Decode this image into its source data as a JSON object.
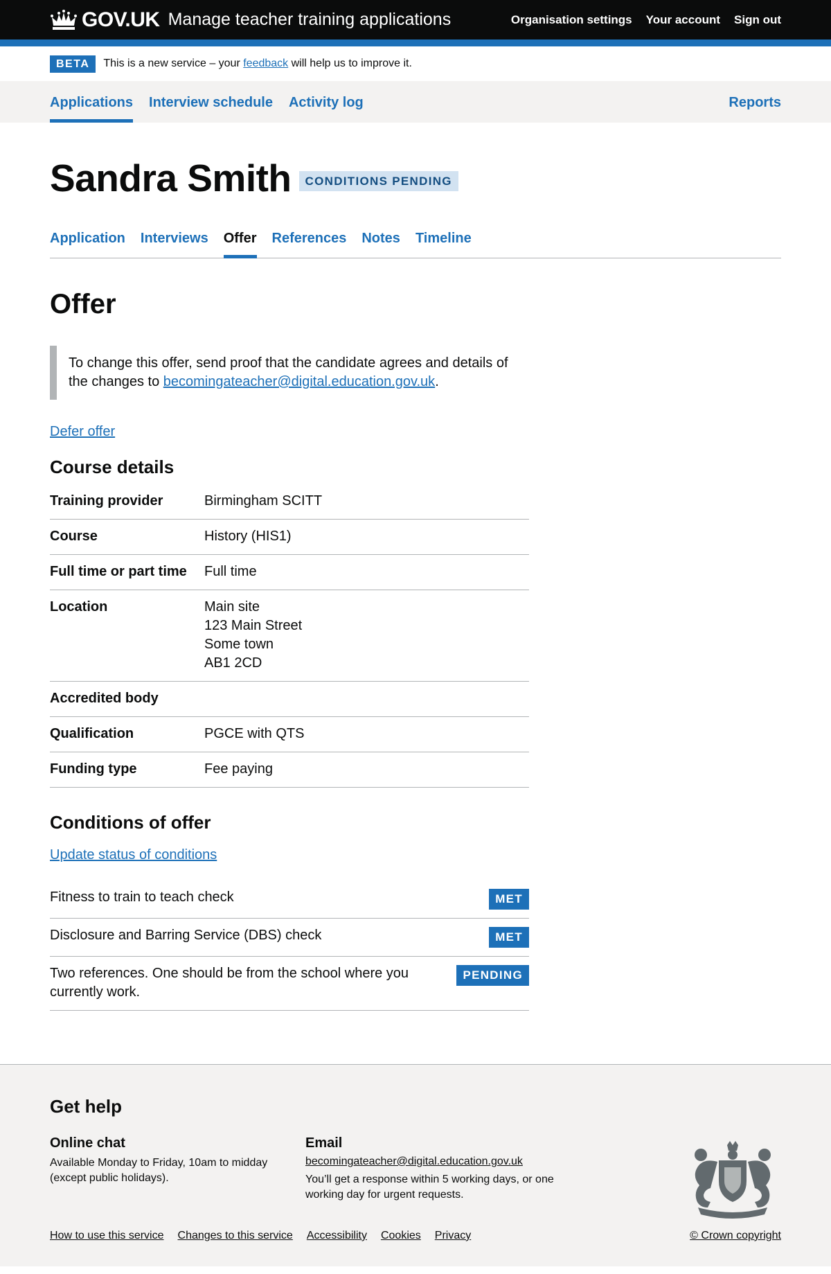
{
  "header": {
    "logo_text": "GOV.UK",
    "service_name": "Manage teacher training applications",
    "nav": [
      "Organisation settings",
      "Your account",
      "Sign out"
    ]
  },
  "beta_banner": {
    "tag": "BETA",
    "text_before": "This is a new service – your ",
    "link": "feedback",
    "text_after": " will help us to improve it."
  },
  "primary_nav": {
    "applications": "Applications",
    "interview_schedule": "Interview schedule",
    "activity_log": "Activity log",
    "reports": "Reports"
  },
  "candidate": {
    "name": "Sandra Smith",
    "status": "CONDITIONS PENDING"
  },
  "sub_nav": [
    "Application",
    "Interviews",
    "Offer",
    "References",
    "Notes",
    "Timeline"
  ],
  "offer": {
    "heading": "Offer",
    "inset_before": "To change this offer, send proof that the candidate agrees and details of the changes to ",
    "inset_link": "becomingateacher@digital.education.gov.uk",
    "inset_after": ".",
    "defer_link": "Defer offer"
  },
  "course_details": {
    "heading": "Course details",
    "rows": [
      {
        "key": "Training provider",
        "value": "Birmingham SCITT"
      },
      {
        "key": "Course",
        "value": "History (HIS1)"
      },
      {
        "key": "Full time or part time",
        "value": "Full time"
      },
      {
        "key": "Location",
        "value": "Main site\n123 Main Street\nSome town\nAB1 2CD"
      },
      {
        "key": "Accredited body",
        "value": ""
      },
      {
        "key": "Qualification",
        "value": "PGCE with QTS"
      },
      {
        "key": "Funding type",
        "value": "Fee paying"
      }
    ]
  },
  "conditions": {
    "heading": "Conditions of offer",
    "update_link": "Update status of conditions",
    "rows": [
      {
        "text": "Fitness to train to teach check",
        "status": "MET"
      },
      {
        "text": "Disclosure and Barring Service (DBS) check",
        "status": "MET"
      },
      {
        "text": "Two references. One should be from the school where you currently work.",
        "status": "PENDING"
      }
    ]
  },
  "footer": {
    "heading": "Get help",
    "chat_heading": "Online chat",
    "chat_text": "Available Monday to Friday, 10am to midday (except public holidays).",
    "email_heading": "Email",
    "email_link": "becomingateacher@digital.education.gov.uk",
    "email_text": "You’ll get a response within 5 working days, or one working day for urgent requests.",
    "links": [
      "How to use this service",
      "Changes to this service",
      "Accessibility",
      "Cookies",
      "Privacy"
    ],
    "copyright": "© Crown copyright"
  }
}
